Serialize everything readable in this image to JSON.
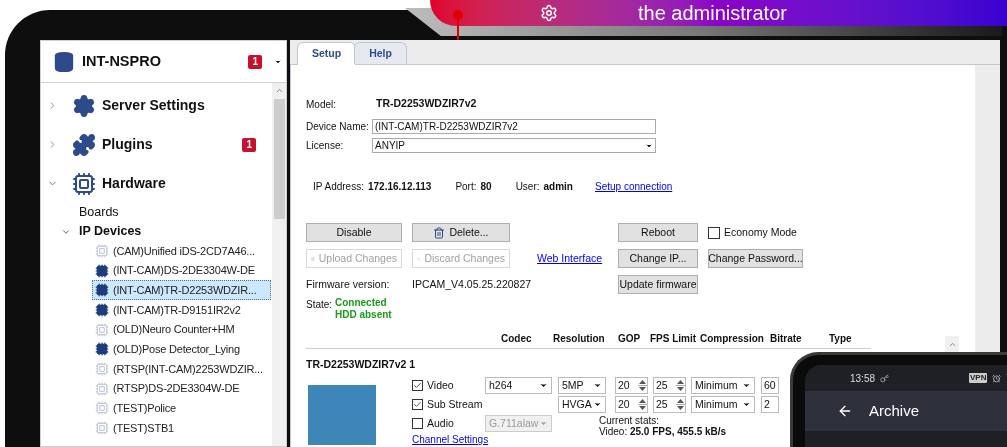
{
  "banner": {
    "text": "the administrator"
  },
  "server": {
    "name": "INT-NSPRO",
    "badge": "1"
  },
  "tree": [
    {
      "label": "Server Settings",
      "kind": "settings",
      "expanded": false
    },
    {
      "label": "Plugins",
      "kind": "plugins",
      "expanded": false,
      "badge": "1"
    },
    {
      "label": "Hardware",
      "kind": "hardware",
      "expanded": true,
      "children": [
        {
          "label": "Boards",
          "kind": "group"
        },
        {
          "label": "IP Devices",
          "kind": "folder",
          "expanded": true,
          "children": [
            {
              "label": "(CAM)Unified iDS-2CD7A46...",
              "kind": "device",
              "active": false,
              "selected": false
            },
            {
              "label": "(INT-CAM)DS-2DE3304W-DE",
              "kind": "device",
              "active": true,
              "selected": false
            },
            {
              "label": "(INT-CAM)TR-D2253WDZIR...",
              "kind": "device",
              "active": true,
              "selected": true
            },
            {
              "label": "(INT-CAM)TR-D9151IR2v2",
              "kind": "device",
              "active": true,
              "selected": false
            },
            {
              "label": "(OLD)Neuro Counter+HM",
              "kind": "device",
              "active": false,
              "selected": false
            },
            {
              "label": "(OLD)Pose Detector_Lying",
              "kind": "device",
              "active": true,
              "selected": false
            },
            {
              "label": "(RTSP(INT-CAM)2253WDZIR...",
              "kind": "device",
              "active": false,
              "selected": false
            },
            {
              "label": "(RTSP)DS-2DE3304W-DE",
              "kind": "device",
              "active": false,
              "selected": false
            },
            {
              "label": "(TEST)Police",
              "kind": "device",
              "active": false,
              "selected": false
            },
            {
              "label": "(TEST)STB1",
              "kind": "device",
              "active": false,
              "selected": false
            }
          ]
        }
      ]
    }
  ],
  "tabs": [
    {
      "label": "Setup",
      "selected": true
    },
    {
      "label": "Help",
      "selected": false
    }
  ],
  "form": {
    "model_label": "Model:",
    "model": "TR-D2253WDZIR7v2",
    "name_label": "Device Name:",
    "name_value": "(INT-CAM)TR-D2253WDZIR7v2",
    "license_label": "License:",
    "license_value": "ANYIP"
  },
  "connection": {
    "ip_label": "IP Address:",
    "ip": "172.16.12.113",
    "port_label": "Port:",
    "port": "80",
    "user_label": "User:",
    "user": "admin",
    "link": "Setup connection"
  },
  "actions": [
    [
      {
        "kind": "button",
        "label": "Disable",
        "disabled": false
      },
      {
        "kind": "delete",
        "label": "Delete...",
        "disabled": false
      },
      {
        "kind": "spacer"
      },
      {
        "kind": "button",
        "label": "Reboot",
        "disabled": false
      },
      {
        "kind": "checkbox",
        "label": "Economy Mode",
        "checked": false
      }
    ],
    [
      {
        "kind": "upload",
        "label": "Upload Changes",
        "disabled": true
      },
      {
        "kind": "discard",
        "label": "Discard Changes",
        "disabled": true
      },
      {
        "kind": "link",
        "label": "Web Interface"
      },
      {
        "kind": "button",
        "label": "Change IP...",
        "disabled": false
      },
      {
        "kind": "button",
        "label": "Change Password...",
        "disabled": false
      }
    ],
    [
      {
        "kind": "label",
        "label": "Firmware version:"
      },
      {
        "kind": "value",
        "label": "IPCAM_V4.05.25.220827"
      },
      {
        "kind": "spacer"
      },
      {
        "kind": "button",
        "label": "Update firmware",
        "disabled": false
      }
    ]
  ],
  "state": {
    "label": "State:",
    "lines": [
      "Connected",
      "HDD absent"
    ]
  },
  "columns": [
    "Codec",
    "Resolution",
    "GOP",
    "FPS Limit",
    "Compression",
    "Bitrate",
    "Type"
  ],
  "channel": {
    "title": "TR-D2253WDZIR7v2 1",
    "settings_link": "Channel Settings",
    "streams": [
      {
        "label": "Video",
        "checked": true,
        "codec": "h264",
        "codec_disabled": false,
        "resolution": "5MP",
        "gop": "20",
        "fps": "25",
        "compression": "Minimum",
        "bitrate": "60"
      },
      {
        "label": "Sub Stream",
        "checked": true,
        "resolution": "HVGA",
        "gop": "20",
        "fps": "25",
        "compression": "Minimum",
        "bitrate": "2"
      },
      {
        "label": "Audio",
        "checked": false,
        "codec": "G.711alaw",
        "codec_disabled": true
      }
    ],
    "stats_title": "Current stats:",
    "stats": "Video: **25.0 FPS, 455.5 kB/s**"
  },
  "phone": {
    "time": "13:58",
    "vpn": "VPN",
    "title": "Archive"
  }
}
